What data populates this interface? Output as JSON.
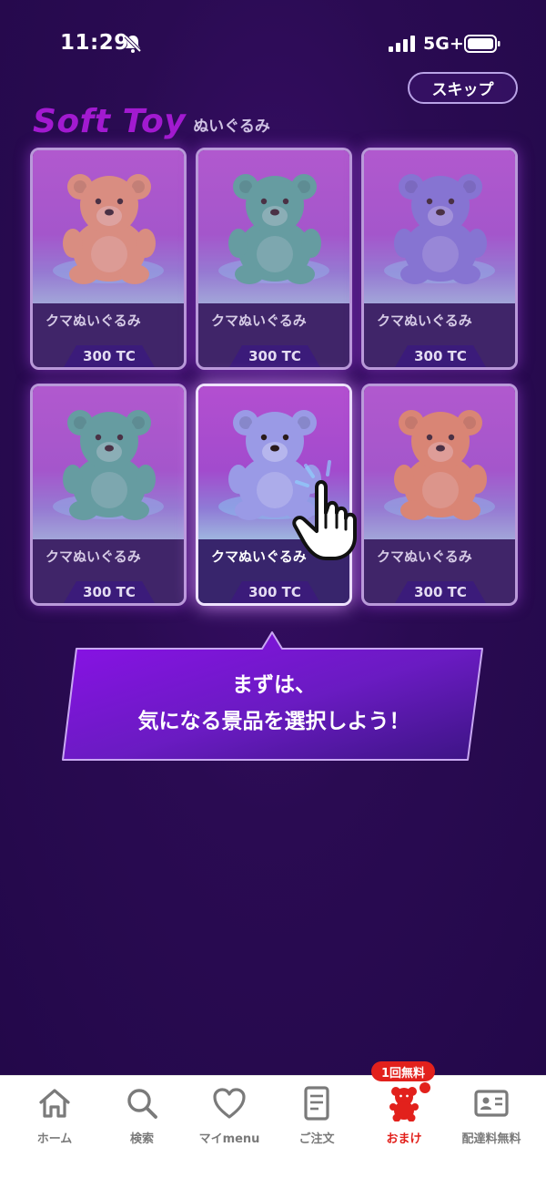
{
  "status_bar": {
    "time": "11:29",
    "network": "5G+"
  },
  "header": {
    "skip_label": "スキップ",
    "title_en": "Soft Toy",
    "title_ja": "ぬいぐるみ"
  },
  "colors": {
    "background": "#2a0a4f",
    "accent": "#a21ad0",
    "active_nav": "#e2211c"
  },
  "items": [
    {
      "name": "クマぬいぐるみ",
      "price": "300 TC",
      "bear_color": "#e8946a",
      "selected": false
    },
    {
      "name": "クマぬいぐるみ",
      "price": "300 TC",
      "bear_color": "#4fa894",
      "selected": false
    },
    {
      "name": "クマぬいぐるみ",
      "price": "300 TC",
      "bear_color": "#7a73d6",
      "selected": false
    },
    {
      "name": "クマぬいぐるみ",
      "price": "300 TC",
      "bear_color": "#4fa894",
      "selected": false
    },
    {
      "name": "クマぬいぐるみ",
      "price": "300 TC",
      "bear_color": "#9a9ae6",
      "selected": true
    },
    {
      "name": "クマぬいぐるみ",
      "price": "300 TC",
      "bear_color": "#e98a5a",
      "selected": false
    }
  ],
  "tooltip": {
    "line1": "まずは、",
    "line2": "気になる景品を選択しよう！"
  },
  "bottom_nav": {
    "items": [
      {
        "label": "ホーム",
        "icon": "home-icon"
      },
      {
        "label": "検索",
        "icon": "search-icon"
      },
      {
        "label": "マイmenu",
        "icon": "heart-icon"
      },
      {
        "label": "ご注文",
        "icon": "document-icon"
      },
      {
        "label": "おまけ",
        "icon": "bear-icon",
        "active": true
      },
      {
        "label": "配達料無料",
        "icon": "id-card-icon"
      }
    ],
    "badge": "1回無料"
  }
}
